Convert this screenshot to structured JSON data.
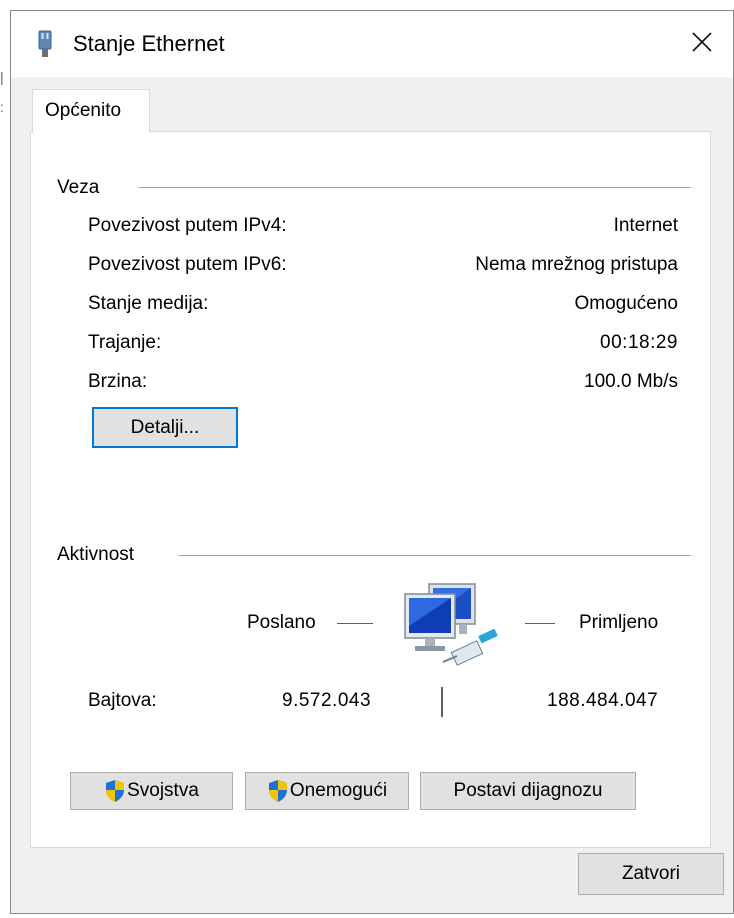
{
  "window": {
    "title": "Stanje Ethernet",
    "close_glyph": "✕"
  },
  "tabs": [
    {
      "label": "Općenito",
      "active": true
    }
  ],
  "connection": {
    "group_label": "Veza",
    "rows": [
      {
        "label": "Povezivost putem IPv4:",
        "value": "Internet"
      },
      {
        "label": "Povezivost putem IPv6:",
        "value": "Nema mrežnog pristupa"
      },
      {
        "label": "Stanje medija:",
        "value": "Omogućeno"
      },
      {
        "label": "Trajanje:",
        "value": "00:18:29"
      },
      {
        "label": "Brzina:",
        "value": "100.0 Mb/s"
      }
    ],
    "details_button": "Detalji..."
  },
  "activity": {
    "group_label": "Aktivnost",
    "sent_label": "Poslano",
    "received_label": "Primljeno",
    "bytes_label": "Bajtova:",
    "bytes_sent": "9.572.043",
    "bytes_received": "188.484.047",
    "icon": "network-computers-icon"
  },
  "actions": {
    "properties_button": "Svojstva",
    "disable_button": "Onemogući",
    "diagnose_button": "Postavi dijagnozu",
    "close_button": "Zatvori"
  },
  "colors": {
    "focus_border": "#0078d7",
    "button_face": "#e1e1e1",
    "dialog_background": "#f0f0f0",
    "shield_blue": "#1e6fd9",
    "shield_yellow": "#f5c400"
  }
}
